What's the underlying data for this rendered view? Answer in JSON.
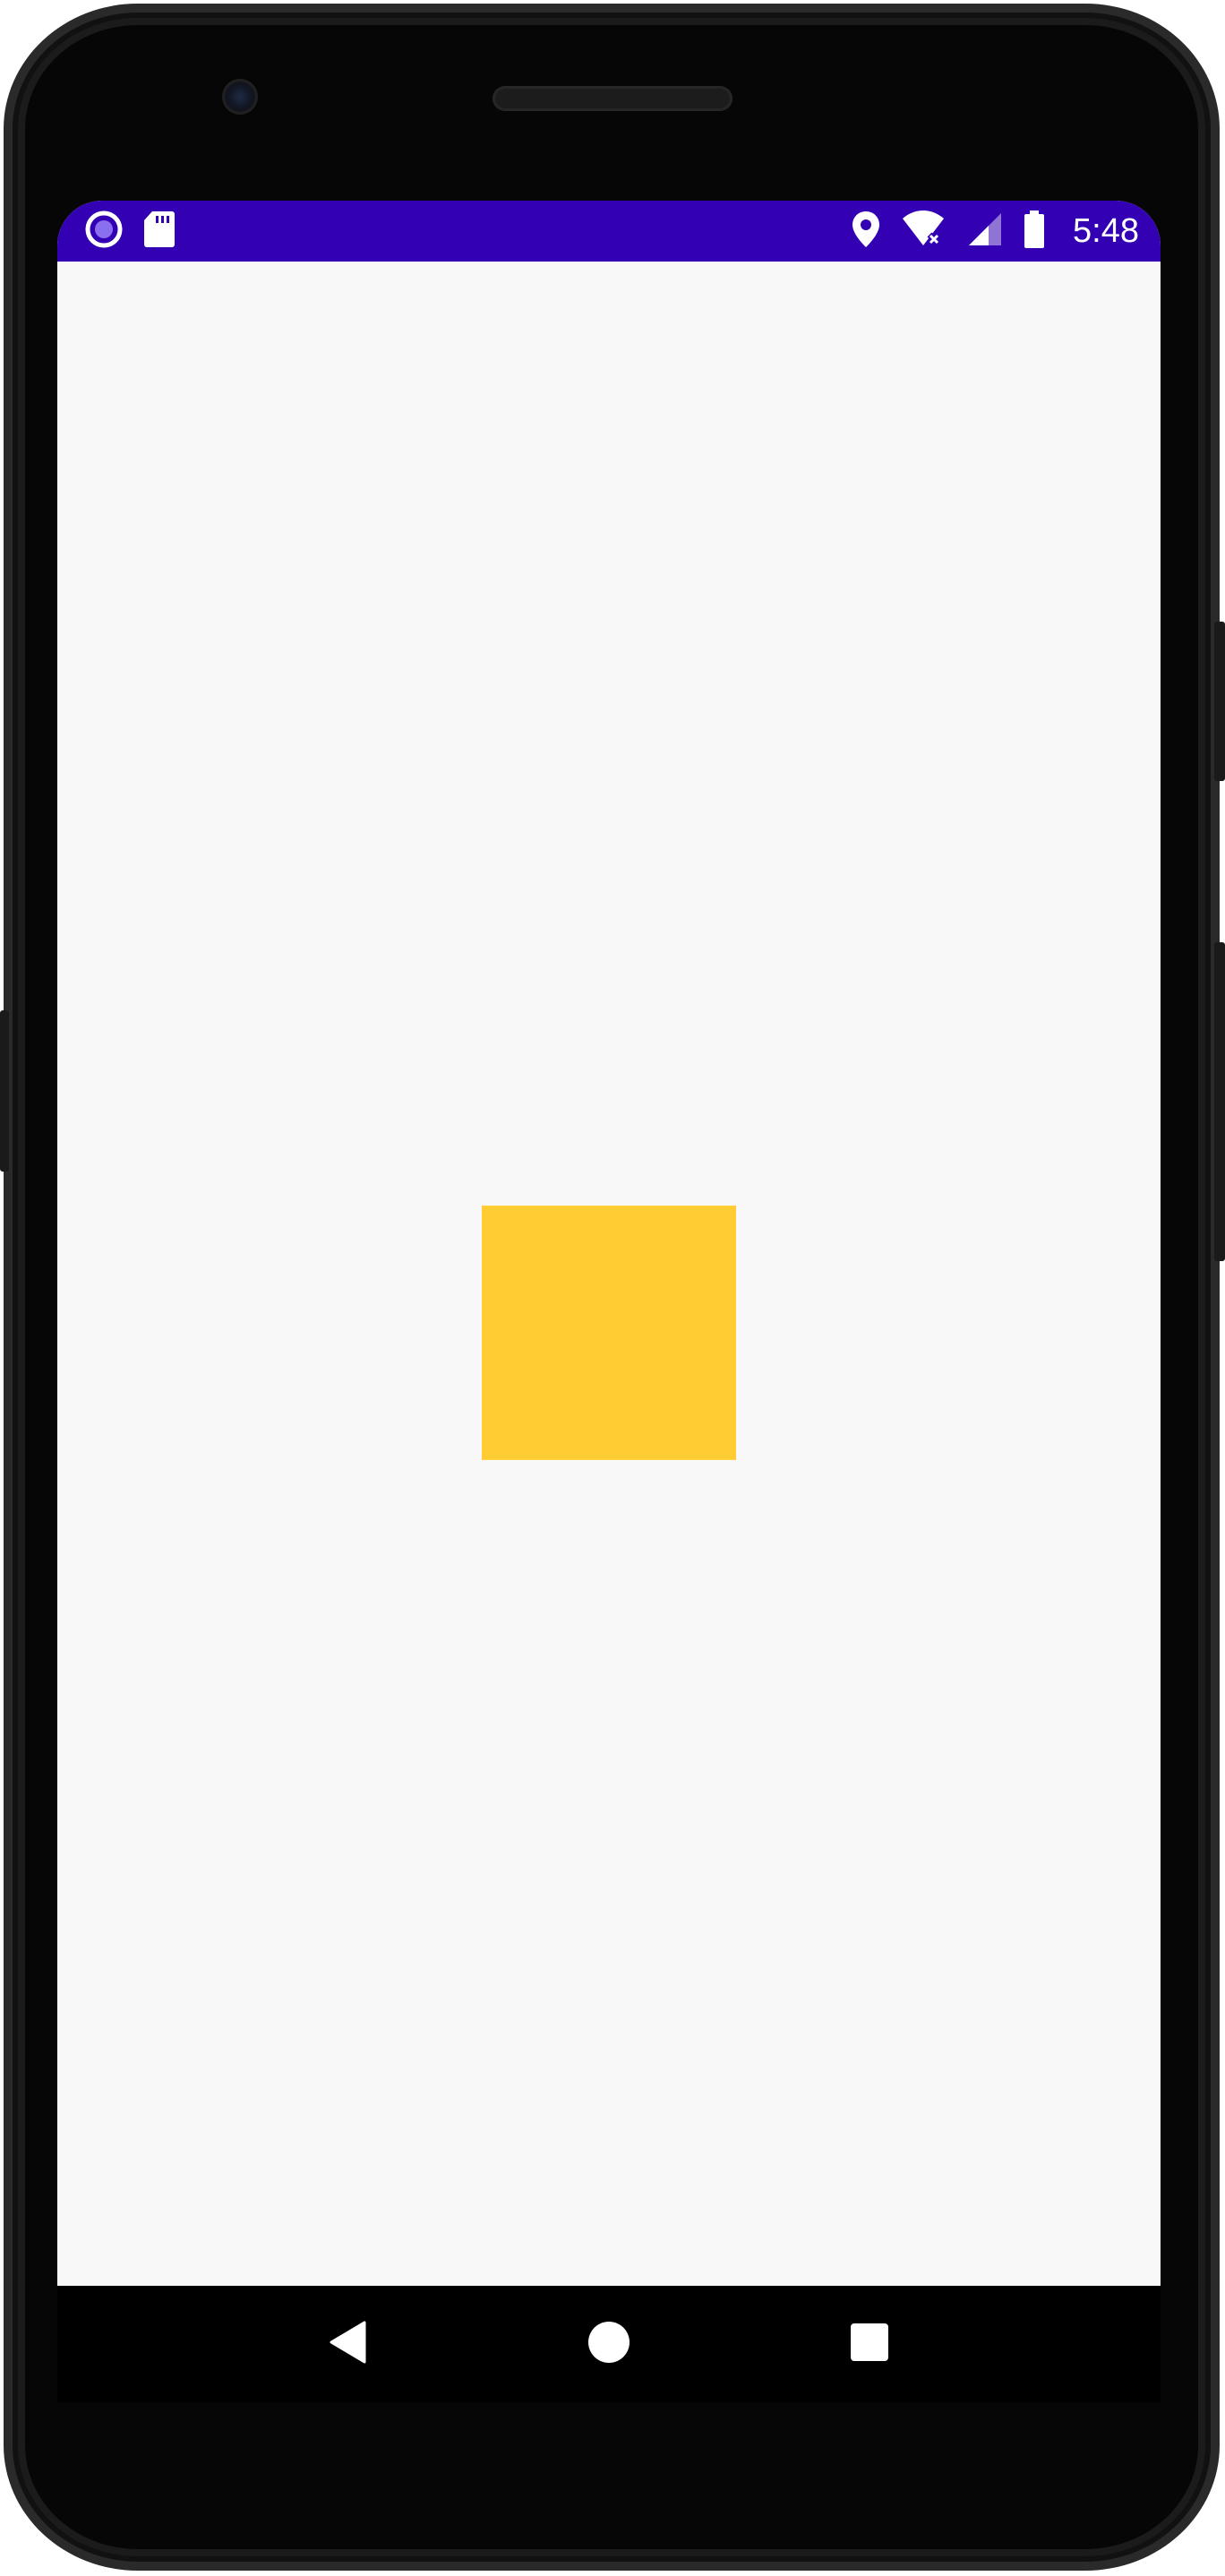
{
  "status_bar": {
    "time": "5:48",
    "background_color": "#3300b3",
    "left_icons": [
      "circle-notification-icon",
      "sd-card-icon"
    ],
    "right_icons": [
      "location-icon",
      "wifi-off-icon",
      "signal-icon",
      "battery-icon"
    ]
  },
  "content": {
    "square_color": "#ffcc33",
    "background_color": "#f8f8f8"
  },
  "nav_bar": {
    "buttons": [
      "back-icon",
      "home-icon",
      "recents-icon"
    ]
  }
}
